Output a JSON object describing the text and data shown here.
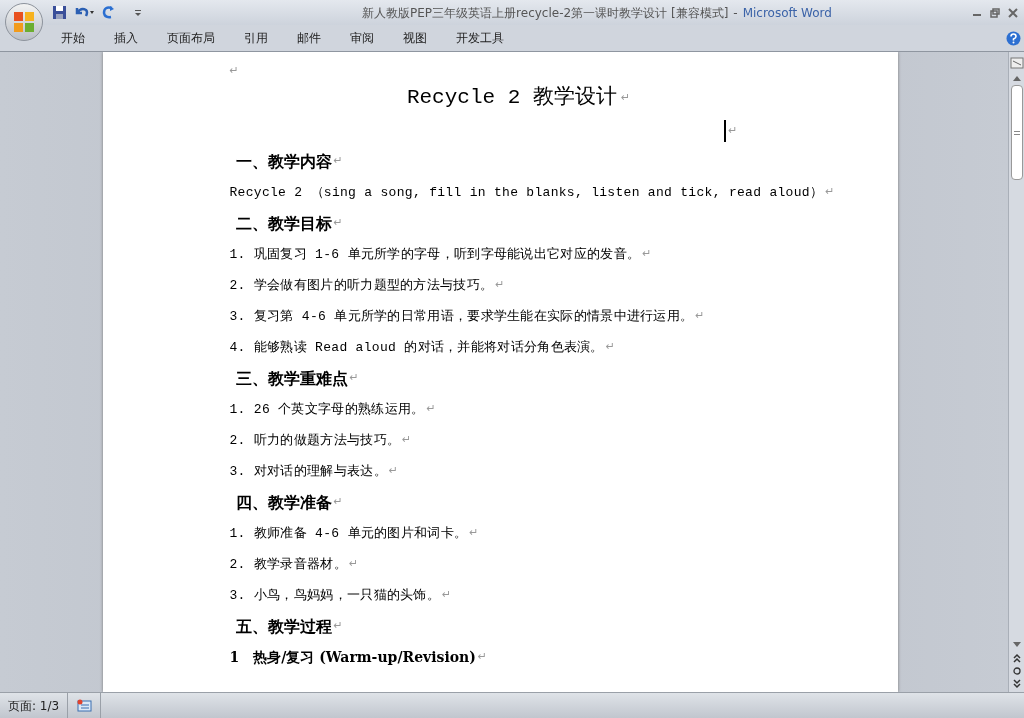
{
  "window": {
    "title": "新人教版PEP三年级英语上册recycle-2第一课时教学设计 [兼容模式]",
    "separator": "-",
    "app": "Microsoft Word"
  },
  "ribbon_tabs": [
    {
      "label": "开始",
      "selected": false
    },
    {
      "label": "插入",
      "selected": false
    },
    {
      "label": "页面布局",
      "selected": false
    },
    {
      "label": "引用",
      "selected": false
    },
    {
      "label": "邮件",
      "selected": false
    },
    {
      "label": "审阅",
      "selected": false
    },
    {
      "label": "视图",
      "selected": false
    },
    {
      "label": "开发工具",
      "selected": false
    }
  ],
  "document": {
    "paragraph_mark": "↵",
    "paragraphs": [
      {
        "kind": "empty"
      },
      {
        "kind": "title",
        "text": "Recycle 2 教学设计"
      },
      {
        "kind": "cursor"
      },
      {
        "kind": "heading",
        "text": "一、教学内容"
      },
      {
        "kind": "body",
        "text": "Recycle 2 （sing a song, fill in the blanks, listen and tick, read aloud）"
      },
      {
        "kind": "heading",
        "text": "二、教学目标"
      },
      {
        "kind": "body",
        "text": "1. 巩固复习 1-6 单元所学的字母，听到字母能说出它对应的发音。"
      },
      {
        "kind": "body",
        "text": "2. 学会做有图片的听力题型的方法与技巧。"
      },
      {
        "kind": "body",
        "text": "3. 复习第 4-6 单元所学的日常用语，要求学生能在实际的情景中进行运用。"
      },
      {
        "kind": "body",
        "text": "4. 能够熟读 Read aloud 的对话，并能将对话分角色表演。"
      },
      {
        "kind": "heading",
        "text": "三、教学重难点"
      },
      {
        "kind": "body",
        "text": "1. 26 个英文字母的熟练运用。"
      },
      {
        "kind": "body",
        "text": "2. 听力的做题方法与技巧。"
      },
      {
        "kind": "body",
        "text": "3. 对对话的理解与表达。"
      },
      {
        "kind": "heading",
        "text": "四、教学准备"
      },
      {
        "kind": "body",
        "text": "1. 教师准备 4-6 单元的图片和词卡。"
      },
      {
        "kind": "body",
        "text": "2. 教学录音器材。"
      },
      {
        "kind": "body",
        "text": "3. 小鸟，鸟妈妈，一只猫的头饰。"
      },
      {
        "kind": "heading",
        "text": "五、教学过程"
      },
      {
        "kind": "subheading",
        "text": "1　热身/复习 (Warm-up/Revision)"
      }
    ]
  },
  "status_bar": {
    "page": "页面: 1/3"
  }
}
